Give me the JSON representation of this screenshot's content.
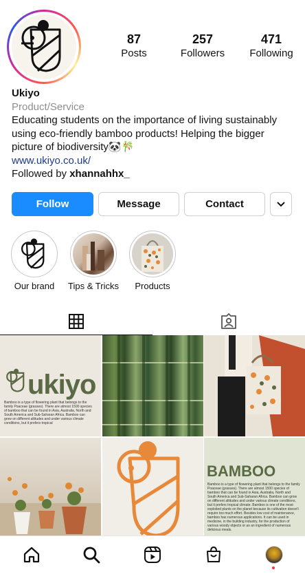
{
  "profile": {
    "name": "Ukiyo",
    "category": "Product/Service",
    "bio": "Educating students on the importance of living sustainably using eco-friendly bamboo products! Helping the bigger picture of biodiversity🐼🎋",
    "website": "www.ukiyo.co.uk/",
    "followed_by_prefix": "Followed by",
    "followed_by_user": "xhannahhx_"
  },
  "stats": [
    {
      "value": "87",
      "label": "Posts"
    },
    {
      "value": "257",
      "label": "Followers"
    },
    {
      "value": "471",
      "label": "Following"
    }
  ],
  "actions": {
    "follow": "Follow",
    "message": "Message",
    "contact": "Contact",
    "more_icon": "chevron-down-icon"
  },
  "highlights": [
    {
      "label": "Our brand"
    },
    {
      "label": "Tips & Tricks"
    },
    {
      "label": "Products"
    }
  ],
  "tabs": [
    {
      "icon": "grid-icon"
    },
    {
      "icon": "tagged-icon"
    }
  ],
  "posts": {
    "p1_title": "ukiyo",
    "p1_text": "Bamboo is a type of flowering plant that belongs to the family Poaceae (grasses). There are almost 1500 species of bamboo that can be found in Asia, Australia, North and South America and Sub-Saharan Africa. Bamboo can grow on different altitudes and under various climate conditions, but it prefers tropical",
    "p6_title": "BAMBOO",
    "p6_text": "Bamboo is a type of flowering plant that belongs to the family Poaceae (grasses). There are almost 1500 species of bamboo that can be found in Asia, Australia, North and South America and Sub-Saharan Africa. Bamboo can grow on different altitudes and under various climate conditions, but it prefers tropical climate. Bamboo is one of the most exploited plants on the planet because its cultivation doesn't require too much effort. Besides low cost of maintenance, bamboo has numerous applications. It can be used in medicine, in the building industry, for the production of various woody objects or as an ingredient of numerous delicious meals."
  },
  "colors": {
    "follow_button": "#1a8cff",
    "link": "#1e3a8a",
    "brand_orange": "#e8893a",
    "brand_green": "#5b6a45"
  },
  "bottom_nav": [
    {
      "icon": "home-icon"
    },
    {
      "icon": "search-icon"
    },
    {
      "icon": "reels-icon"
    },
    {
      "icon": "shop-icon"
    },
    {
      "icon": "profile-avatar"
    }
  ]
}
